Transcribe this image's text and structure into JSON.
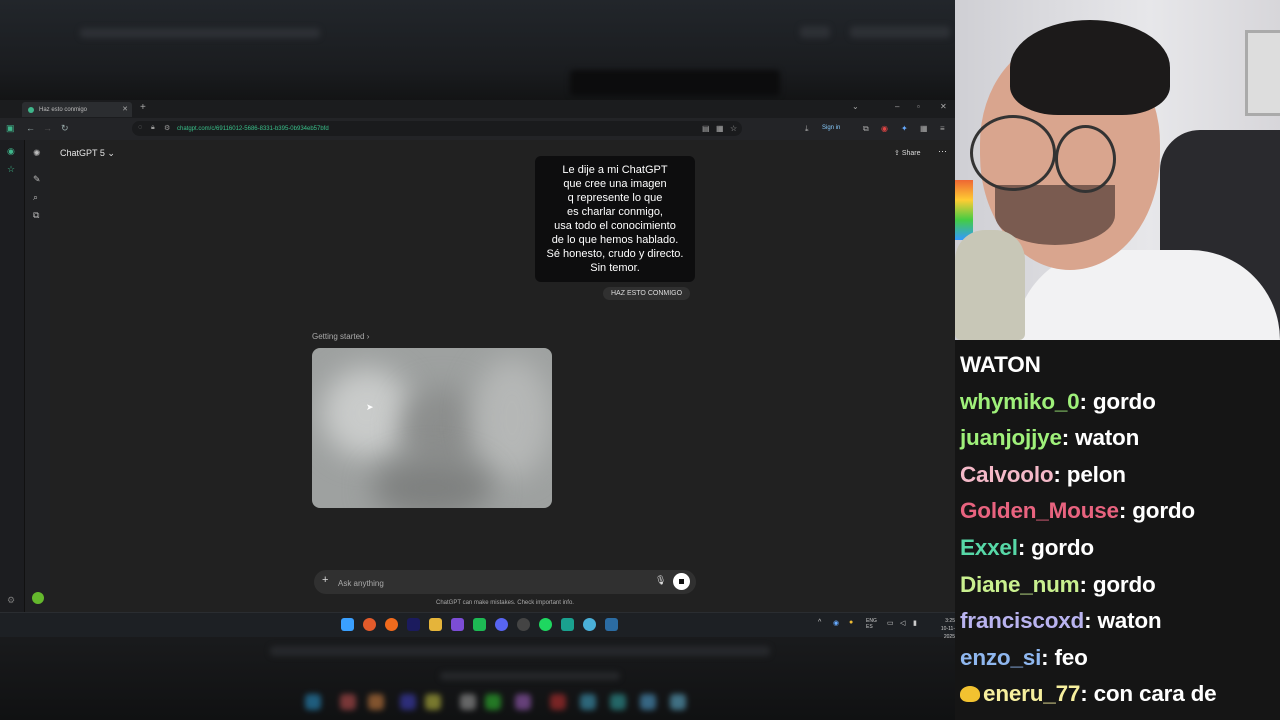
{
  "browser": {
    "tab_title": "Haz esto conmigo",
    "url": "chatgpt.com/c/69116012-5686-8331-b395-0b934eb57bfd",
    "sign_in_label": "Sign in"
  },
  "chat_app": {
    "model_label": "ChatGPT 5",
    "share_label": "Share",
    "user_image_text": [
      "Le dije a mi ChatGPT",
      "que cree una imagen",
      "q represente lo que",
      "es charlar conmigo,",
      "usa todo el conocimiento",
      "de lo que hemos hablado.",
      "Sé honesto, crudo y directo.",
      "Sin temor."
    ],
    "user_caption": "HAZ ESTO CONMIGO",
    "getting_started": "Getting started",
    "composer_placeholder": "Ask anything",
    "disclaimer": "ChatGPT can make mistakes. Check important info."
  },
  "taskbar": {
    "lang": "ENG",
    "region": "ES",
    "time": "3:25",
    "date": "10-11-2025"
  },
  "stream_chat": {
    "messages": [
      {
        "user": "",
        "text": "WATON",
        "color": "#ffffff"
      },
      {
        "user": "whymiko_0",
        "text": "gordo",
        "color": "#9ff07a"
      },
      {
        "user": "juanjojjye",
        "text": "waton",
        "color": "#9ff07a"
      },
      {
        "user": "Calvoolo",
        "text": "pelon",
        "color": "#f4b9c8"
      },
      {
        "user": "Golden_Mouse",
        "text": "gordo",
        "color": "#e8637f"
      },
      {
        "user": "Exxel",
        "text": "gordo",
        "color": "#57d8a7"
      },
      {
        "user": "Diane_num",
        "text": "gordo",
        "color": "#c9f08f"
      },
      {
        "user": "franciscoxd",
        "text": "waton",
        "color": "#b9b3ef"
      },
      {
        "user": "enzo_si",
        "text": "feo",
        "color": "#8fb7ef"
      },
      {
        "user": "eneru_77",
        "text": "con cara de",
        "color": "#f6ef9e"
      }
    ]
  }
}
